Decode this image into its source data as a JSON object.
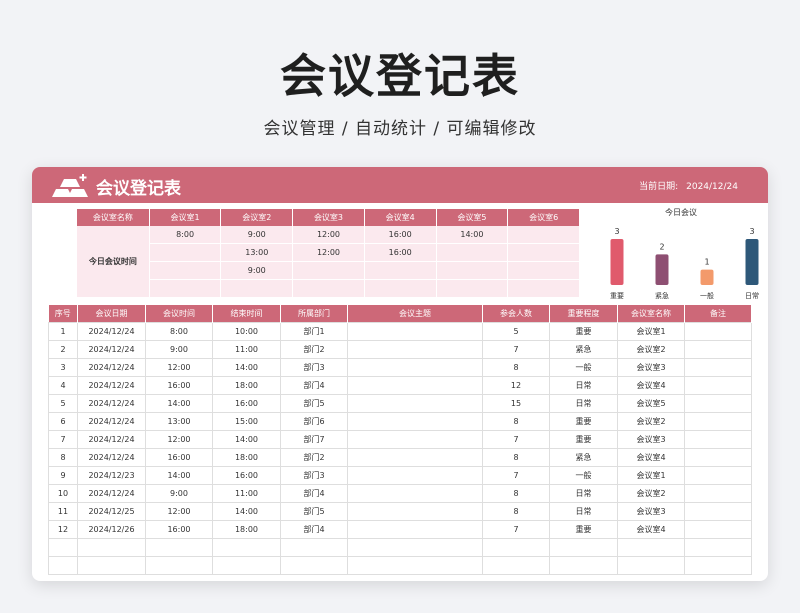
{
  "page": {
    "title": "会议登记表",
    "subtitle": "会议管理 / 自动统计 / 可编辑修改"
  },
  "header": {
    "title": "会议登记表",
    "date_label": "当前日期:",
    "date_value": "2024/12/24",
    "accent_color": "#cd6878"
  },
  "schedule": {
    "corner_label": "会议室名称",
    "row_label": "今日会议时间",
    "rooms": [
      "会议室1",
      "会议室2",
      "会议室3",
      "会议室4",
      "会议室5",
      "会议室6"
    ],
    "times": [
      [
        "8:00",
        "9:00",
        "12:00",
        "16:00",
        "14:00",
        ""
      ],
      [
        "",
        "13:00",
        "12:00",
        "16:00",
        "",
        ""
      ],
      [
        "",
        "9:00",
        "",
        "",
        "",
        ""
      ],
      [
        "",
        "",
        "",
        "",
        "",
        ""
      ]
    ]
  },
  "chart_data": {
    "type": "bar",
    "title": "今日会议",
    "categories": [
      "重要",
      "紧急",
      "一般",
      "日常"
    ],
    "values": [
      3,
      2,
      1,
      3
    ],
    "colors": [
      "#e05a6c",
      "#8e4f72",
      "#f39a6b",
      "#2e5879"
    ],
    "ylim": [
      0,
      3
    ],
    "data_labels": true,
    "grid": false
  },
  "table": {
    "headers": [
      "序号",
      "会议日期",
      "会议时间",
      "结束时间",
      "所属部门",
      "会议主题",
      "参会人数",
      "重要程度",
      "会议室名称",
      "备注"
    ],
    "rows": [
      [
        "1",
        "2024/12/24",
        "8:00",
        "10:00",
        "部门1",
        "",
        "5",
        "重要",
        "会议室1",
        ""
      ],
      [
        "2",
        "2024/12/24",
        "9:00",
        "11:00",
        "部门2",
        "",
        "7",
        "紧急",
        "会议室2",
        ""
      ],
      [
        "3",
        "2024/12/24",
        "12:00",
        "14:00",
        "部门3",
        "",
        "8",
        "一般",
        "会议室3",
        ""
      ],
      [
        "4",
        "2024/12/24",
        "16:00",
        "18:00",
        "部门4",
        "",
        "12",
        "日常",
        "会议室4",
        ""
      ],
      [
        "5",
        "2024/12/24",
        "14:00",
        "16:00",
        "部门5",
        "",
        "15",
        "日常",
        "会议室5",
        ""
      ],
      [
        "6",
        "2024/12/24",
        "13:00",
        "15:00",
        "部门6",
        "",
        "8",
        "重要",
        "会议室2",
        ""
      ],
      [
        "7",
        "2024/12/24",
        "12:00",
        "14:00",
        "部门7",
        "",
        "7",
        "重要",
        "会议室3",
        ""
      ],
      [
        "8",
        "2024/12/24",
        "16:00",
        "18:00",
        "部门2",
        "",
        "8",
        "紧急",
        "会议室4",
        ""
      ],
      [
        "9",
        "2024/12/23",
        "14:00",
        "16:00",
        "部门3",
        "",
        "7",
        "一般",
        "会议室1",
        ""
      ],
      [
        "10",
        "2024/12/24",
        "9:00",
        "11:00",
        "部门4",
        "",
        "8",
        "日常",
        "会议室2",
        ""
      ],
      [
        "11",
        "2024/12/25",
        "12:00",
        "14:00",
        "部门5",
        "",
        "8",
        "日常",
        "会议室3",
        ""
      ],
      [
        "12",
        "2024/12/26",
        "16:00",
        "18:00",
        "部门4",
        "",
        "7",
        "重要",
        "会议室4",
        ""
      ],
      [
        "",
        "",
        "",
        "",
        "",
        "",
        "",
        "",
        "",
        ""
      ],
      [
        "",
        "",
        "",
        "",
        "",
        "",
        "",
        "",
        "",
        ""
      ]
    ]
  }
}
